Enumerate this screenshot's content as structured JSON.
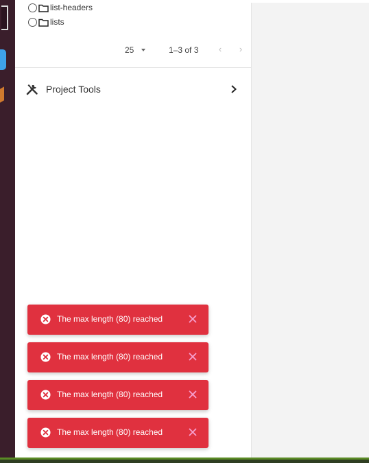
{
  "tree": {
    "items": [
      {
        "label": "list-headers"
      },
      {
        "label": "lists"
      }
    ]
  },
  "pagination": {
    "page_size": "25",
    "range": "1–3 of 3",
    "prev_icon": "chevron-left-icon",
    "next_icon": "chevron-right-icon"
  },
  "project_tools": {
    "label": "Project Tools",
    "icon": "tools-icon",
    "chevron_icon": "chevron-right-icon"
  },
  "toasts": [
    {
      "message": "The max length (80) reached"
    },
    {
      "message": "The max length (80) reached"
    },
    {
      "message": "The max length (80) reached"
    },
    {
      "message": "The max length (80) reached"
    }
  ],
  "colors": {
    "toast_bg": "#e0313f",
    "toast_close": "#f7a0cf",
    "sidebar_dark": "#3a1e2b",
    "right_area": "#f3f3f3"
  }
}
